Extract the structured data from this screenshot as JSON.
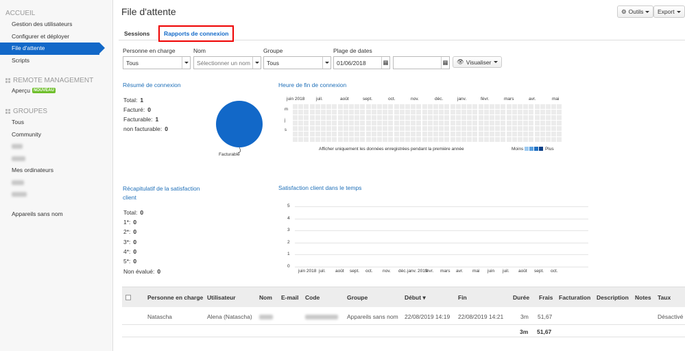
{
  "sidebar": {
    "accueil": "ACCUEIL",
    "home_items": [
      "Gestion des utilisateurs",
      "Configurer et déployer",
      "File d'attente",
      "Scripts"
    ],
    "remote": "REMOTE MANAGEMENT",
    "apercu": "Aperçu",
    "badge": "NOUVEAU",
    "groupes": "GROUPES",
    "groups_visible": [
      "Tous",
      "Community"
    ],
    "mes_ordinateurs": "Mes ordinateurs",
    "appareils": "Appareils sans nom"
  },
  "header": {
    "title": "File d'attente",
    "outils": "Outils",
    "export": "Export"
  },
  "tabs": [
    "Sessions",
    "Rapports de connexion"
  ],
  "filters": {
    "labels": [
      "Personne en charge",
      "Nom",
      "Groupe",
      "Plage de dates"
    ],
    "personne": "Tous",
    "nom_placeholder": "Sélectionner un nom",
    "groupe": "Tous",
    "date_from": "01/06/2018",
    "date_to": "",
    "visualiser": "Visualiser"
  },
  "resume": {
    "title": "Résumé de connexion",
    "rows": [
      {
        "label": "Total:",
        "value": "1"
      },
      {
        "label": "Facturé:",
        "value": "0"
      },
      {
        "label": "Facturable:",
        "value": "1"
      },
      {
        "label": "non facturable:",
        "value": "0"
      }
    ],
    "pie_label": "Facturable"
  },
  "heatmap": {
    "title": "Heure de fin de connexion",
    "months": [
      "juin 2018",
      "juil.",
      "août",
      "sept.",
      "oct.",
      "nov.",
      "déc.",
      "janv.",
      "févr.",
      "mars",
      "avr.",
      "mai"
    ],
    "days": [
      "m",
      "j",
      "s"
    ],
    "note": "Afficher uniquement les données enregistrées pendant la première année",
    "less": "Moins",
    "more": "Plus",
    "colors": [
      "#9cc9f0",
      "#5aa0e0",
      "#1f6fc2",
      "#0b3f86"
    ]
  },
  "satisfaction": {
    "title": "Récapitulatif de la satisfaction client",
    "rows": [
      {
        "label": "Total:",
        "value": "0"
      },
      {
        "label": "1*:",
        "value": "0"
      },
      {
        "label": "2*:",
        "value": "0"
      },
      {
        "label": "3*:",
        "value": "0"
      },
      {
        "label": "4*:",
        "value": "0"
      },
      {
        "label": "5*:",
        "value": "0"
      },
      {
        "label": "Non évalué:",
        "value": "0"
      }
    ]
  },
  "chart_data": {
    "type": "line",
    "title": "Satisfaction client dans le temps",
    "categories": [
      "juin 2018",
      "juil.",
      "août",
      "sept.",
      "oct.",
      "nov.",
      "déc.",
      "janv. 2019",
      "févr.",
      "mars",
      "avr.",
      "mai",
      "juin",
      "juil.",
      "août",
      "sept.",
      "oct."
    ],
    "yticks": [
      "0",
      "1",
      "2",
      "3",
      "4",
      "5"
    ],
    "ylim": [
      0,
      5
    ],
    "series": []
  },
  "table": {
    "headers": [
      "Personne en charge",
      "Utilisateur",
      "Nom",
      "E-mail",
      "Code",
      "Groupe",
      "Début ▾",
      "Fin",
      "Durée",
      "Frais",
      "Facturation",
      "Description",
      "Notes",
      "Taux"
    ],
    "row": {
      "personne": "Natascha",
      "utilisateur": "Alena (Natascha)",
      "groupe": "Appareils sans nom",
      "debut": "22/08/2019 14:19",
      "fin": "22/08/2019 14:21",
      "duree": "3m",
      "frais": "51,67",
      "taux": "Désactivé"
    },
    "total": {
      "duree": "3m",
      "frais": "51,67"
    }
  }
}
